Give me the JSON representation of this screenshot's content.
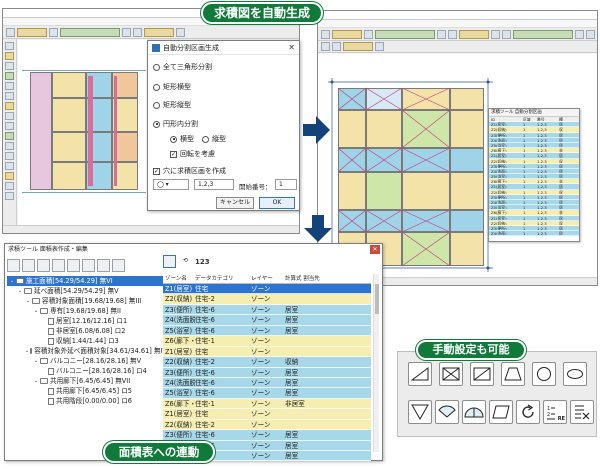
{
  "badges": {
    "top": "求積図を自動生成",
    "manual": "手動設定も可能",
    "bottom": "面積表への連動"
  },
  "dialog": {
    "title": "自動分割区画生成",
    "opt_triangle": "全て三角形分割",
    "opt_rect_h": "矩形横型",
    "opt_rect_v": "矩形縦型",
    "opt_circle": "円形内分割",
    "sub_horizontal": "横型",
    "sub_vertical": "縦型",
    "chk_rotate": "回転を考慮",
    "chk_hole": "穴に求積区画を作成",
    "number_format": "1,2,3",
    "start_label": "開始番号：",
    "start_value": "1",
    "cancel": "キャンセル",
    "ok": "OK"
  },
  "areawin": {
    "title": "求積ツール 面積表作成・編集",
    "tree": [
      {
        "label": "施工面積[54.29/54.29] 無VI",
        "indent": 0,
        "sel": true
      },
      {
        "label": "延べ面積[54.29/54.29] 無V",
        "indent": 1
      },
      {
        "label": "容積対象面積[19.68/19.68] 無III",
        "indent": 2
      },
      {
        "label": "専有[19.68/19.68] 無II",
        "indent": 3
      },
      {
        "label": "居室[12.16/12.16] ロ1",
        "indent": 4,
        "doc": true
      },
      {
        "label": "非居室[6.08/6.08] ロ2",
        "indent": 4,
        "doc": true
      },
      {
        "label": "収納[1.44/1.44] ロ3",
        "indent": 4,
        "doc": true
      },
      {
        "label": "容積対象外延べ面積対象[34.61/34.61] 無IV",
        "indent": 2
      },
      {
        "label": "バルコニー[28.16/28.16] 無V",
        "indent": 3
      },
      {
        "label": "バルコニー[28.16/28.16] ロ4",
        "indent": 4,
        "doc": true
      },
      {
        "label": "共用廊下[6.45/6.45] 無VII",
        "indent": 3
      },
      {
        "label": "共用廊下[6.45/6.45] ロ5",
        "indent": 4,
        "doc": true
      },
      {
        "label": "共用階段[0.00/0.00] ロ6",
        "indent": 4,
        "doc": true
      }
    ],
    "tool_123": "123",
    "headers": [
      "ゾーン名",
      "データカテゴリ",
      "レイヤー",
      "計算式 割当先"
    ],
    "rows": [
      {
        "c1": "Z1(居室)",
        "c2": "住宅",
        "c3": "ゾーン",
        "c4": "",
        "style": "sel"
      },
      {
        "c1": "Z2(収納)",
        "c2": "住宅-2",
        "c3": "ゾーン",
        "c4": "",
        "style": "yel"
      },
      {
        "c1": "Z3(便所)",
        "c2": "住宅-6",
        "c3": "ゾーン",
        "c4": "居室",
        "style": "blue"
      },
      {
        "c1": "Z4(洗面脱",
        "c2": "住宅-6",
        "c3": "ゾーン",
        "c4": "居室",
        "style": "blue"
      },
      {
        "c1": "Z5(浴室)",
        "c2": "住宅-6",
        "c3": "ゾーン",
        "c4": "居室",
        "style": "blue"
      },
      {
        "c1": "Z6(廊下・",
        "c2": "住宅-1",
        "c3": "ゾーン",
        "c4": "",
        "style": "yel"
      },
      {
        "c1": "Z1(居室)",
        "c2": "住宅",
        "c3": "ゾーン",
        "c4": "",
        "style": "yel"
      },
      {
        "c1": "Z2(収納)",
        "c2": "住宅-2",
        "c3": "ゾーン",
        "c4": "収納",
        "style": "blue"
      },
      {
        "c1": "Z3(便所)",
        "c2": "住宅-6",
        "c3": "ゾーン",
        "c4": "居室",
        "style": "blue"
      },
      {
        "c1": "Z4(洗面脱",
        "c2": "住宅-6",
        "c3": "ゾーン",
        "c4": "居室",
        "style": "blue"
      },
      {
        "c1": "Z5(浴室)",
        "c2": "住宅-6",
        "c3": "ゾーン",
        "c4": "居室",
        "style": "blue"
      },
      {
        "c1": "Z6(廊下・",
        "c2": "住宅-1",
        "c3": "ゾーン",
        "c4": "非居室",
        "style": "yel"
      },
      {
        "c1": "Z1(居室)",
        "c2": "住宅",
        "c3": "ゾーン",
        "c4": "",
        "style": "yel"
      },
      {
        "c1": "Z2(収納)",
        "c2": "住宅-2",
        "c3": "ゾーン",
        "c4": "",
        "style": "yel"
      },
      {
        "c1": "Z3(便所)",
        "c2": "住宅-6",
        "c3": "ゾーン",
        "c4": "居室",
        "style": "blue"
      },
      {
        "c1": "Z4(洗面脱",
        "c2": "住宅-6",
        "c3": "ゾーン",
        "c4": "居室",
        "style": "blue"
      },
      {
        "c1": "Z5(浴室)",
        "c2": "住宅-6",
        "c3": "ゾーン",
        "c4": "居室",
        "style": "blue"
      }
    ]
  },
  "ftable": {
    "title": "求積ツール 自動分割区画",
    "headers": [
      "ID",
      "区域",
      "番号",
      "種"
    ],
    "rows": [
      [
        "Z1(居室)",
        "1",
        "1,2,3",
        "居"
      ],
      [
        "Z2(収納)",
        "1",
        "1,2,3",
        "収"
      ],
      [
        "Z3(便所)",
        "1",
        "1,2,3",
        "居"
      ],
      [
        "Z4(洗面)",
        "1",
        "1,2,3",
        "居"
      ],
      [
        "Z5(浴室)",
        "1",
        "1,2,3",
        "居"
      ],
      [
        "Z6(廊下)",
        "1",
        "1,2,3",
        "非"
      ],
      [
        "Z1(居室)",
        "1",
        "1,2,3",
        "居"
      ],
      [
        "Z2(収納)",
        "1",
        "1,2,3",
        "収"
      ],
      [
        "Z3(便所)",
        "1",
        "1,2,3",
        "居"
      ],
      [
        "Z4(洗面)",
        "1",
        "1,2,3",
        "居"
      ],
      [
        "Z5(浴室)",
        "1",
        "1,2,3",
        "居"
      ],
      [
        "Z6(廊下)",
        "1",
        "1,2,3",
        "非"
      ],
      [
        "Z1(居室)",
        "1",
        "1,2,3",
        "居"
      ],
      [
        "Z2(収納)",
        "1",
        "1,2,3",
        "収"
      ],
      [
        "Z3(便所)",
        "1",
        "1,2,3",
        "居"
      ],
      [
        "Z4(洗面)",
        "1",
        "1,2,3",
        "居"
      ],
      [
        "Z5(浴室)",
        "1",
        "1,2,3",
        "居"
      ],
      [
        "Z6(廊下)",
        "1",
        "1,2,3",
        "非"
      ],
      [
        "Z1(居室)",
        "1",
        "1,2,3",
        "居"
      ],
      [
        "Z2(収納)",
        "1",
        "1,2,3",
        "収"
      ],
      [
        "Z3(便所)",
        "1",
        "1,2,3",
        "居"
      ],
      [
        "Z4(洗面)",
        "1",
        "1,2,3",
        "居"
      ]
    ]
  },
  "palette": {
    "tools": [
      "triangle-split",
      "rect-cross",
      "rect-diagonal",
      "trapezoid",
      "circle",
      "ellipse",
      "inverted-triangle",
      "pie-sector",
      "half-circle",
      "parallelogram",
      "rotate",
      "renumber",
      "delete-zone"
    ],
    "renumber_label": "RE"
  },
  "colors": {
    "badge_green": "#0f7a3a",
    "arrow_navy": "#14437c",
    "row_blue": "#a6d8ea",
    "row_yellow": "#f6eeb1",
    "selection": "#2c74cf"
  }
}
